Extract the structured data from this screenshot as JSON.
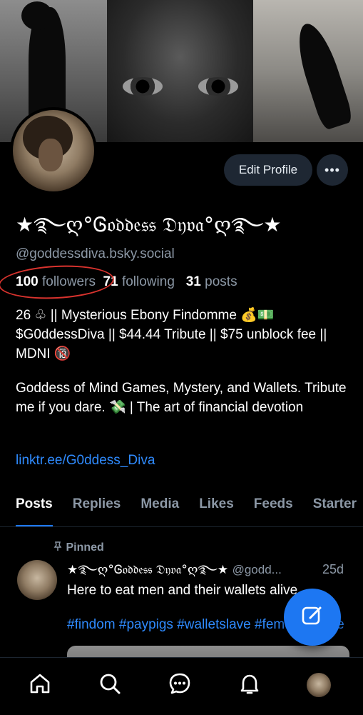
{
  "profile": {
    "edit_label": "Edit Profile",
    "more_label": "•••",
    "display_name": "★࿐ღ°Ꮆ𝔬𝔡𝔡𝔢𝔰𝔰 𝔇𝔶𝔳𝔞°ღ࿐★",
    "handle": "@goddessdiva.bsky.social",
    "followers_count": "100",
    "followers_label": "followers",
    "following_count": "71",
    "following_label": "following",
    "posts_count": "31",
    "posts_label": "posts",
    "bio_paragraph_1": "26 ♧ || Mysterious Ebony Findomme 💰💵 $G0ddessDiva || $44.44 Tribute || $75 unblock fee || MDNI 🔞",
    "bio_paragraph_2": "Goddess of Mind Games, Mystery, and Wallets. Tribute me if you dare. 💸 | The art of financial devotion",
    "link": "linktr.ee/G0ddess_Diva"
  },
  "tabs": [
    {
      "label": "Posts"
    },
    {
      "label": "Replies"
    },
    {
      "label": "Media"
    },
    {
      "label": "Likes"
    },
    {
      "label": "Feeds"
    },
    {
      "label": "Starter"
    }
  ],
  "post": {
    "pinned_label": "Pinned",
    "author_name": "★࿐ღ°Ꮆ𝔬𝔡𝔡𝔢𝔰𝔰 𝔇𝔶𝔳𝔞°ღ࿐★",
    "author_handle": "@godd...",
    "time": "25d",
    "text": "Here to eat men and their wallets alive",
    "tags": "#findom #paypigs #walletslave #femdom #fine"
  },
  "icons": {
    "pin": "pin-icon",
    "compose": "compose-icon",
    "home": "home-icon",
    "search": "search-icon",
    "chat": "chat-icon",
    "notifications": "bell-icon"
  },
  "colors": {
    "accent": "#1d77f2",
    "link": "#2f8bff",
    "muted": "#8c98a6",
    "button_bg": "#1e2733",
    "annotation_circle": "#d9332e"
  }
}
